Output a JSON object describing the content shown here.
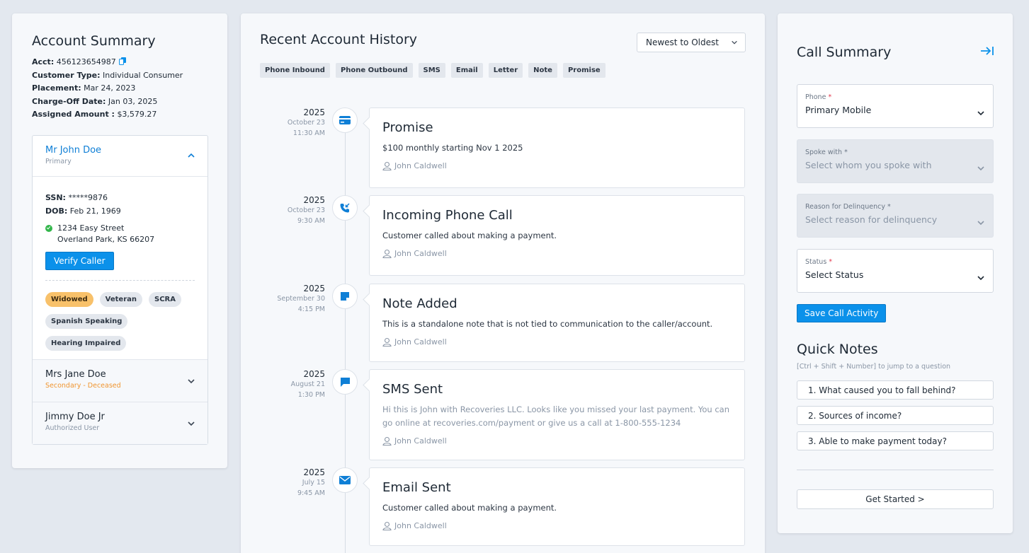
{
  "account_summary": {
    "title": "Account Summary",
    "acct_label": "Acct:",
    "acct_value": "456123654987",
    "customer_type_label": "Customer Type:",
    "customer_type_value": "Individual Consumer",
    "placement_label": "Placement:",
    "placement_value": "Mar 24, 2023",
    "charge_off_label": "Charge-Off Date:",
    "charge_off_value": "Jan 03, 2025",
    "assigned_label": "Assigned Amount :",
    "assigned_value": "$3,579.27"
  },
  "contacts": [
    {
      "name": "Mr John Doe",
      "role": "Primary",
      "ssn_label": "SSN:",
      "ssn_value": "*****9876",
      "dob_label": "DOB:",
      "dob_value": "Feb 21, 1969",
      "address_line1": "1234 Easy Street",
      "address_line2": "Overland Park, KS 66207",
      "verify_label": "Verify Caller",
      "tags": [
        "Widowed",
        "Veteran",
        "SCRA",
        "Spanish Speaking",
        "Hearing Impaired"
      ]
    },
    {
      "name": "Mrs Jane Doe",
      "role": "Secondary - Deceased"
    },
    {
      "name": "Jimmy Doe Jr",
      "role": "Authorized User"
    }
  ],
  "history": {
    "title": "Recent Account History",
    "sort_value": "Newest to Oldest",
    "filters": [
      "Phone Inbound",
      "Phone Outbound",
      "SMS",
      "Email",
      "Letter",
      "Note",
      "Promise"
    ],
    "items": [
      {
        "year": "2025",
        "day": "October 23",
        "time": "11:30 AM",
        "icon": "credit-card-icon",
        "title": "Promise",
        "desc": "$100 monthly starting Nov 1 2025",
        "agent": "John Caldwell"
      },
      {
        "year": "2025",
        "day": "October 23",
        "time": "9:30 AM",
        "icon": "phone-incoming-icon",
        "title": "Incoming Phone Call",
        "desc": "Customer called about making a payment.",
        "agent": "John Caldwell"
      },
      {
        "year": "2025",
        "day": "September 30",
        "time": "4:15 PM",
        "icon": "note-icon",
        "title": "Note Added",
        "desc": "This is a standalone note that is not tied to communication to the caller/account.",
        "agent": "John Caldwell"
      },
      {
        "year": "2025",
        "day": "August 21",
        "time": "1:30 PM",
        "icon": "chat-bubble-icon",
        "title": "SMS Sent",
        "desc": "Hi this is John with Recoveries LLC. Looks like you missed your last payment. You can go online at recoveries.com/payment or give us a call at 1-800-555-1234",
        "agent": "John Caldwell"
      },
      {
        "year": "2025",
        "day": "July 15",
        "time": "9:45 AM",
        "icon": "envelope-icon",
        "title": "Email Sent",
        "desc": "Customer called about making a payment.",
        "agent": "John Caldwell"
      }
    ]
  },
  "call_summary": {
    "title": "Call Summary",
    "phone_label": "Phone",
    "phone_value": "Primary Mobile",
    "spoke_label": "Spoke with",
    "spoke_placeholder": "Select whom you spoke with",
    "reason_label": "Reason for Delinquency",
    "reason_placeholder": "Select reason for delinquency",
    "status_label": "Status",
    "status_value": "Select Status",
    "required_mark": "*",
    "save_label": "Save Call Activity"
  },
  "quick_notes": {
    "title": "Quick Notes",
    "hint": "[Ctrl + Shift + Number] to jump to a question",
    "items": [
      "1. What caused you to fall behind?",
      "2. Sources of income?",
      "3. Able to make payment today?"
    ],
    "get_started": "Get Started >"
  },
  "colors": {
    "accent": "#0b91ea",
    "link": "#0f7fd6",
    "warning_tag": "#f8c16a",
    "success": "#33b64b"
  }
}
